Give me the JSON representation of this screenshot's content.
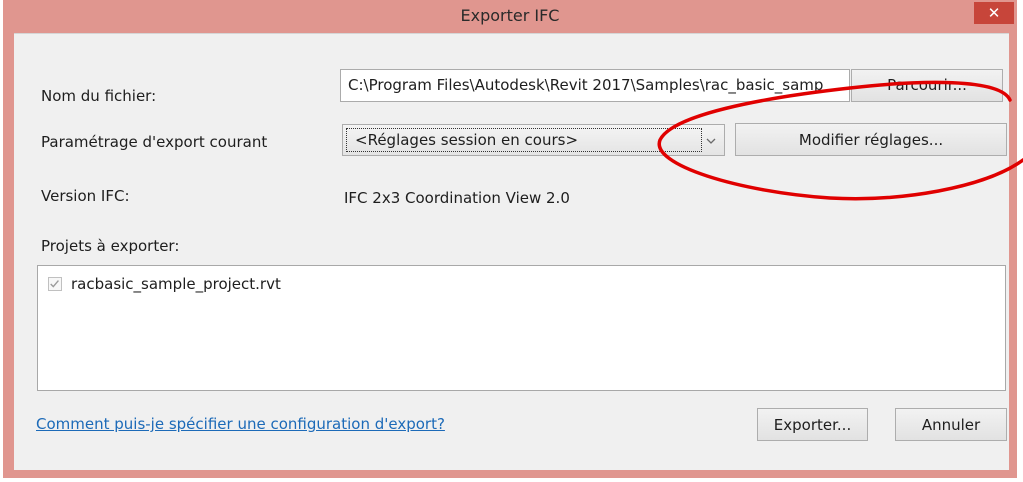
{
  "window": {
    "title": "Exporter IFC",
    "close_glyph": "✕"
  },
  "form": {
    "filename_label": "Nom du fichier:",
    "filename_value": "C:\\Program Files\\Autodesk\\Revit 2017\\Samples\\rac_basic_samp",
    "browse_button": "Parcourir...",
    "export_setup_label": "Paramétrage d'export courant",
    "export_setup_selected": "<Réglages session en cours>",
    "modify_button": "Modifier réglages...",
    "ifc_version_label": "Version IFC:",
    "ifc_version_value": "IFC 2x3 Coordination View 2.0",
    "projects_label": "Projets à exporter:"
  },
  "projects": [
    {
      "name": "racbasic_sample_project.rvt",
      "checked": true
    }
  ],
  "footer": {
    "help_link": "Comment puis-je spécifier une configuration d'export?",
    "export_button": "Exporter...",
    "cancel_button": "Annuler"
  },
  "colors": {
    "frame": "#e0968f",
    "close_button": "#c7453a",
    "annotation": "#e00000",
    "link": "#1c6ab8"
  },
  "icons": {
    "close": "close-icon",
    "dropdown": "chevron-down-icon",
    "checkbox": "checkmark-icon"
  }
}
